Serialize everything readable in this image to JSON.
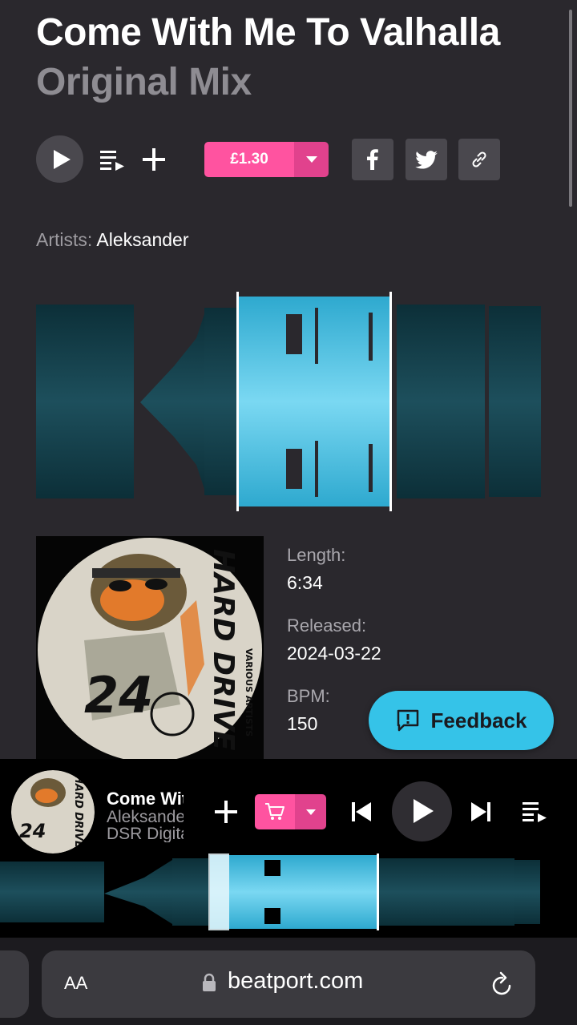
{
  "track": {
    "title": "Come With Me To Valhalla",
    "mix": "Original Mix",
    "price": "£1.30",
    "artists_label": "Artists:",
    "artists": "Aleksander"
  },
  "details": [
    {
      "label": "Length:",
      "value": "6:34"
    },
    {
      "label": "Released:",
      "value": "2024-03-22"
    },
    {
      "label": "BPM:",
      "value": "150"
    }
  ],
  "feedback": {
    "label": "Feedback"
  },
  "player": {
    "title": "Come With Me To Valhalla",
    "artist": "Aleksander",
    "label": "DSR Digital"
  },
  "artwork": {
    "text_vertical": "HARD DRIVE",
    "number": "24",
    "small_text": "VARIOUS ARTISTS"
  },
  "browser": {
    "aa": "AA",
    "domain": "beatport.com"
  },
  "colors": {
    "accent_pink": "#ff53a0",
    "accent_cyan": "#35c3e8",
    "wave_dark": "#0f3a44"
  }
}
